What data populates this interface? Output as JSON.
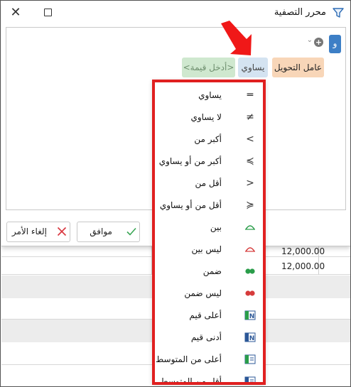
{
  "dialog": {
    "title": "محرر التصفية",
    "group_operator": "و"
  },
  "condition": {
    "field": "عامل التحويل",
    "operator": "يساوي",
    "value_placeholder": "<أدخل قيمة>"
  },
  "buttons": {
    "ok": "موافق",
    "cancel": "إلغاء الأمر"
  },
  "background_grid": {
    "values": [
      "12,000.00",
      "12,000.00"
    ]
  },
  "operators_menu": [
    {
      "label": "يساوي",
      "icon": "equals-icon"
    },
    {
      "label": "لا يساوي",
      "icon": "not-equals-icon"
    },
    {
      "label": "أكبر من",
      "icon": "greater-than-icon"
    },
    {
      "label": "أكبر من أو يساوي",
      "icon": "greater-or-equal-icon"
    },
    {
      "label": "أقل من",
      "icon": "less-than-icon"
    },
    {
      "label": "أقل من أو يساوي",
      "icon": "less-or-equal-icon"
    },
    {
      "label": "بين",
      "icon": "between-icon"
    },
    {
      "label": "ليس بين",
      "icon": "not-between-icon"
    },
    {
      "label": "ضمن",
      "icon": "in-icon"
    },
    {
      "label": "ليس ضمن",
      "icon": "not-in-icon"
    },
    {
      "label": "أعلى قيم",
      "icon": "top-values-icon"
    },
    {
      "label": "أدنى قيم",
      "icon": "bottom-values-icon"
    },
    {
      "label": "أعلى من المتوسط",
      "icon": "above-average-icon"
    },
    {
      "label": "أقل من المتوسط",
      "icon": "below-average-icon"
    }
  ],
  "colors": {
    "highlight_border": "#e02020",
    "field_chip": "#f8d6b8",
    "operator_chip": "#d4e3f1",
    "value_chip": "#cfe8cf",
    "group_chip": "#3d7fc6"
  }
}
